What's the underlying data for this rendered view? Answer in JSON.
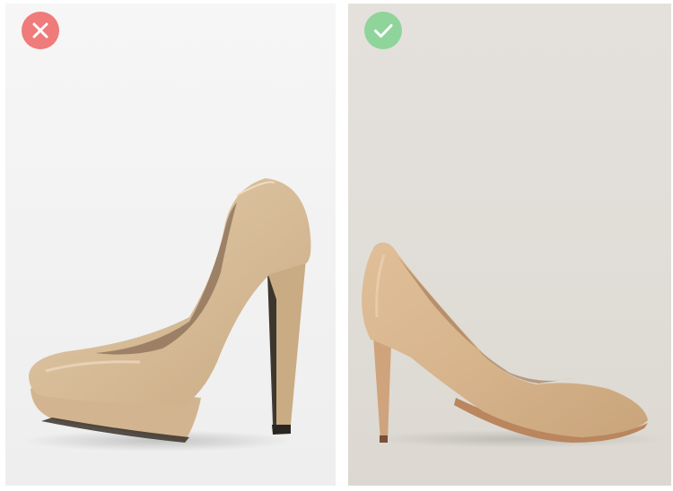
{
  "comparison": {
    "left": {
      "verdict": "incorrect",
      "badge_icon": "cross-icon",
      "badge_color": "#ef7b7b",
      "shoe_color": "#d9bf9c"
    },
    "right": {
      "verdict": "correct",
      "badge_icon": "check-icon",
      "badge_color": "#8fd49a",
      "shoe_color": "#d8b690"
    }
  }
}
